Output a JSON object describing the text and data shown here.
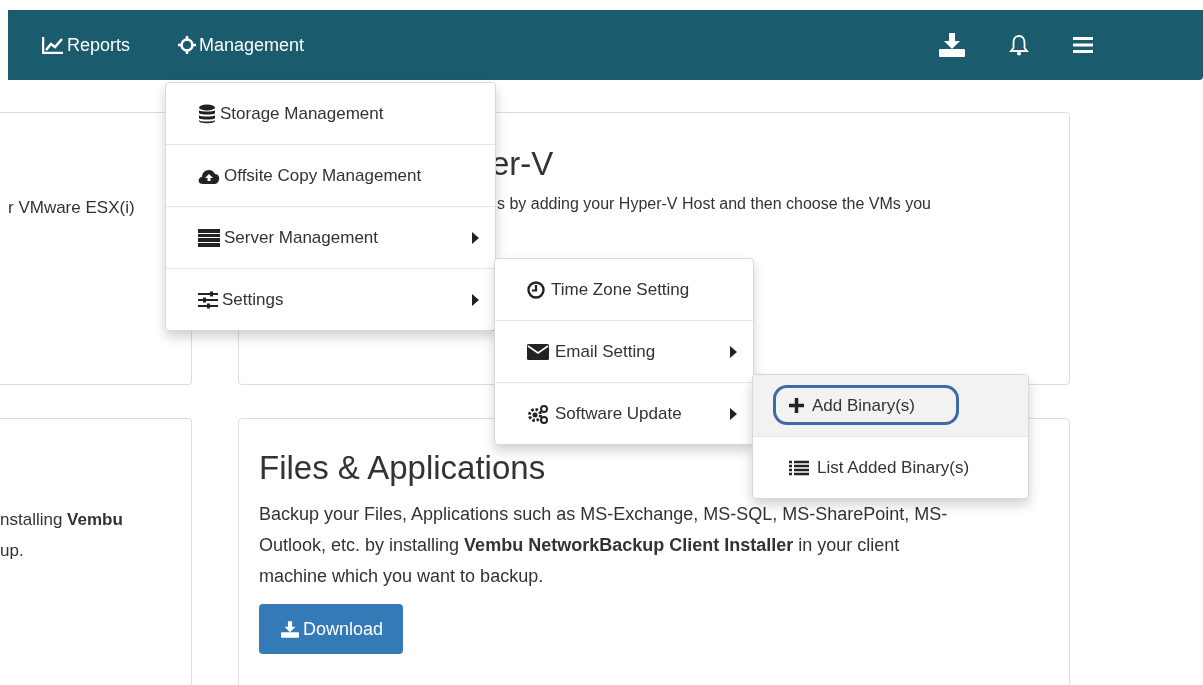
{
  "nav": {
    "links": [
      {
        "label": "Reports"
      },
      {
        "label": "Management"
      }
    ]
  },
  "management_menu": {
    "items": [
      {
        "label": "Storage Management",
        "has_submenu": false
      },
      {
        "label": "Offsite Copy Management",
        "has_submenu": false
      },
      {
        "label": "Server Management",
        "has_submenu": true
      },
      {
        "label": "Settings",
        "has_submenu": true
      }
    ]
  },
  "settings_submenu": {
    "items": [
      {
        "label": "Time Zone Setting",
        "has_submenu": false
      },
      {
        "label": "Email Setting",
        "has_submenu": true
      },
      {
        "label": "Software Update",
        "has_submenu": true
      }
    ]
  },
  "software_update_submenu": {
    "items": [
      {
        "label": "Add Binary(s)",
        "selected": true
      },
      {
        "label": "List Added Binary(s)",
        "selected": false
      }
    ]
  },
  "vmware_card": {
    "text": "r VMware ESX(i)"
  },
  "hyperv_card": {
    "title": "er-V",
    "text": "s by adding your Hyper-V Host and then choose the VMs you"
  },
  "agent_card": {
    "lines": [
      "nstalling **Vembu**",
      "up."
    ]
  },
  "files_card": {
    "title": "Files & Applications",
    "text": "Backup your Files, Applications such as MS-Exchange, MS-SQL, MS-SharePoint, MS-Outlook, etc. by installing **Vembu NetworkBackup Client Installer** in your client machine which you want to backup.",
    "button": "Download"
  }
}
